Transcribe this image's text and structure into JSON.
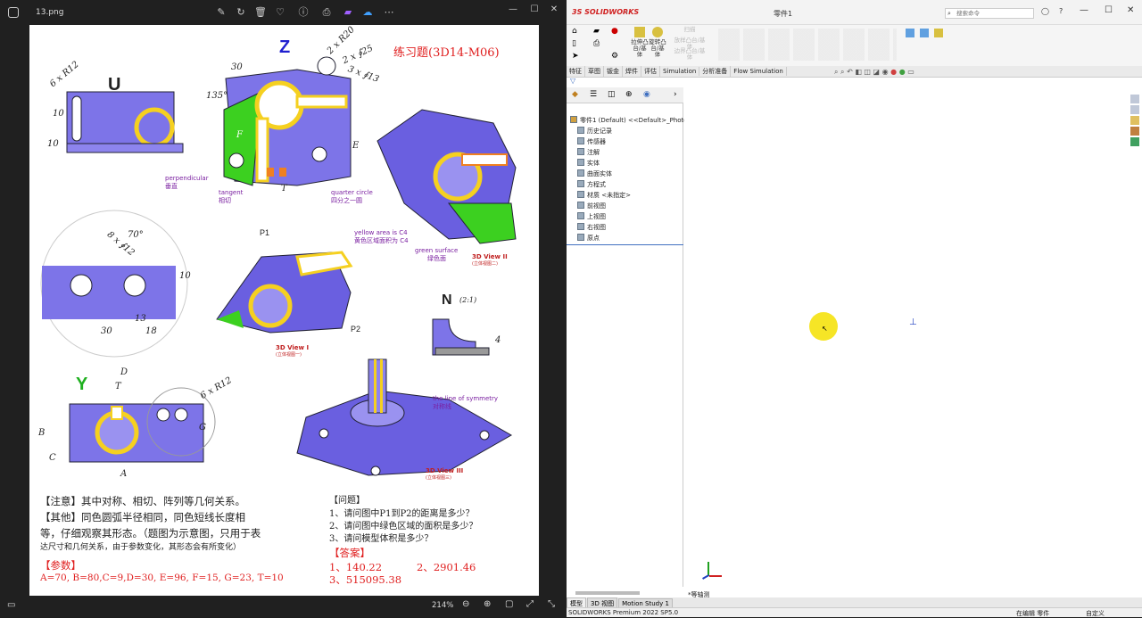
{
  "viewer": {
    "filename": "13.png",
    "zoom": "214%",
    "window_controls": [
      "—",
      "☐",
      "✕"
    ]
  },
  "drawing": {
    "title": "练习题(3D14-M06)",
    "views": {
      "U": "U",
      "Z": "Z",
      "Y": "Y",
      "N": "N",
      "N_scale": "(2:1)",
      "P1": "P1",
      "P2": "P2"
    },
    "dims": {
      "u_r": "6 x R12",
      "u_10a": "10",
      "u_10b": "10",
      "z_2xR20": "2 x R20",
      "z_2xf25": "2 x ∮25",
      "z_3xf13": "3 x ∮13",
      "z_30": "30",
      "z_135": "135°",
      "z_F": "F",
      "z_E": "E",
      "z_T": "T",
      "c_70": "70°",
      "c_8xf12": "8 x ∮12",
      "c_10": "10",
      "c_13": "13",
      "c_30": "30",
      "c_18": "18",
      "y_D": "D",
      "y_T": "T",
      "y_6xR12": "6 x R12",
      "y_B": "B",
      "y_C": "C",
      "y_A": "A",
      "y_G": "G",
      "n_4": "4"
    },
    "notes": {
      "perpendicular_en": "perpendicular",
      "perpendicular_cn": "垂直",
      "tangent_en": "tangent",
      "tangent_cn": "相切",
      "quarter_en": "quarter circle",
      "quarter_cn": "四分之一圆",
      "yellow_en": "yellow area is C4",
      "yellow_cn": "黄色区域面积为 C4",
      "green_en": "green surface",
      "green_cn": "绿色面",
      "view1": "3D View I",
      "view1_cn": "(立体视图一)",
      "view2": "3D View II",
      "view2_cn": "(立体视图二)",
      "view3": "3D View III",
      "view3_cn": "(立体视图三)",
      "sym_en": "the line of symmetry",
      "sym_cn": "对称线"
    },
    "text": {
      "note1": "【注意】其中对称、相切、阵列等几何关系。",
      "note2": "【其他】同色圆弧半径相同，同色短线长度相",
      "note3": "等，仔细观察其形态。（题图为示意图，只用于表",
      "note4": "达尺寸和几何关系，由于参数变化，其形态会有所变化）",
      "param_h": "【参数】",
      "params": "A=70, B=80,C=9,D=30, E=96, F=15, G=23, T=10",
      "q_h": "【问题】",
      "q1": "1、请问图中P1到P2的距离是多少？",
      "q2": "2、请问图中绿色区域的面积是多少？",
      "q3": "3、请问模型体积是多少？",
      "a_h": "【答案】",
      "a1": "1、140.22",
      "a2": "2、2901.46",
      "a3": "3、515095.38"
    }
  },
  "sw": {
    "brand": "SOLIDWORKS",
    "doc_title": "零件1",
    "search_placeholder": "搜索命令",
    "ribbon": [
      {
        "label": "拉伸凸台/基体"
      },
      {
        "label": "旋转凸台/基体"
      },
      {
        "label": "扫描"
      },
      {
        "label": "放样凸台/基体"
      },
      {
        "label": "边界凸台/基体"
      }
    ],
    "cm_tabs": [
      "特征",
      "草图",
      "钣金",
      "焊件",
      "评估",
      "Simulation",
      "分析准备",
      "Flow Simulation"
    ],
    "tree": [
      {
        "label": "零件1 (Default) <<Default>_Photo\\"
      },
      {
        "label": "历史记录"
      },
      {
        "label": "传感器"
      },
      {
        "label": "注解"
      },
      {
        "label": "实体"
      },
      {
        "label": "曲面实体"
      },
      {
        "label": "方程式"
      },
      {
        "label": "材质 <未指定>"
      },
      {
        "label": "前视图"
      },
      {
        "label": "上视图"
      },
      {
        "label": "右视图"
      },
      {
        "label": "原点"
      }
    ],
    "view_label": "*等轴测",
    "bottom_tabs": [
      "模型",
      "3D 视图",
      "Motion Study 1"
    ],
    "status_left": "SOLIDWORKS Premium 2022 SP5.0",
    "status_mid": "在编辑 零件",
    "status_right": "自定义"
  },
  "colors": {
    "part_purple": "#6a5fe0",
    "part_yellow": "#f5d020",
    "part_green": "#3cd020",
    "part_orange": "#f08020",
    "cursor_highlight": "#f5e000"
  }
}
